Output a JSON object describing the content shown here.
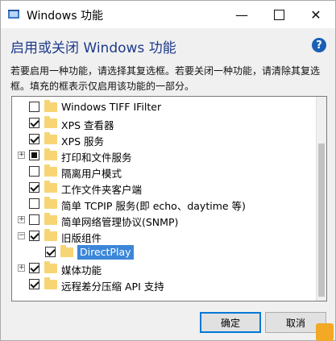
{
  "window": {
    "title": "Windows 功能",
    "min_glyph": "—",
    "close_glyph": "✕"
  },
  "heading": "启用或关闭 Windows 功能",
  "help_glyph": "?",
  "description": "若要启用一种功能，请选择其复选框。若要关闭一种功能，请清除其复选框。填充的框表示仅启用该功能的一部分。",
  "features": [
    {
      "label": "Windows TIFF IFilter",
      "state": "unchecked",
      "expandable": false
    },
    {
      "label": "XPS 查看器",
      "state": "checked",
      "expandable": false
    },
    {
      "label": "XPS 服务",
      "state": "checked",
      "expandable": false
    },
    {
      "label": "打印和文件服务",
      "state": "partial",
      "expandable": true
    },
    {
      "label": "隔离用户模式",
      "state": "unchecked",
      "expandable": false
    },
    {
      "label": "工作文件夹客户端",
      "state": "checked",
      "expandable": false
    },
    {
      "label": "简单 TCPIP 服务(即 echo、daytime 等)",
      "state": "unchecked",
      "expandable": false
    },
    {
      "label": "简单网络管理协议(SNMP)",
      "state": "unchecked",
      "expandable": true
    },
    {
      "label": "旧版组件",
      "state": "checked",
      "expandable": true,
      "expanded": true
    },
    {
      "label": "DirectPlay",
      "state": "checked",
      "expandable": false,
      "child": true,
      "selected": true
    },
    {
      "label": "媒体功能",
      "state": "checked",
      "expandable": true
    },
    {
      "label": "远程差分压缩 API 支持",
      "state": "checked",
      "expandable": false
    }
  ],
  "buttons": {
    "ok": "确定",
    "cancel": "取消"
  }
}
